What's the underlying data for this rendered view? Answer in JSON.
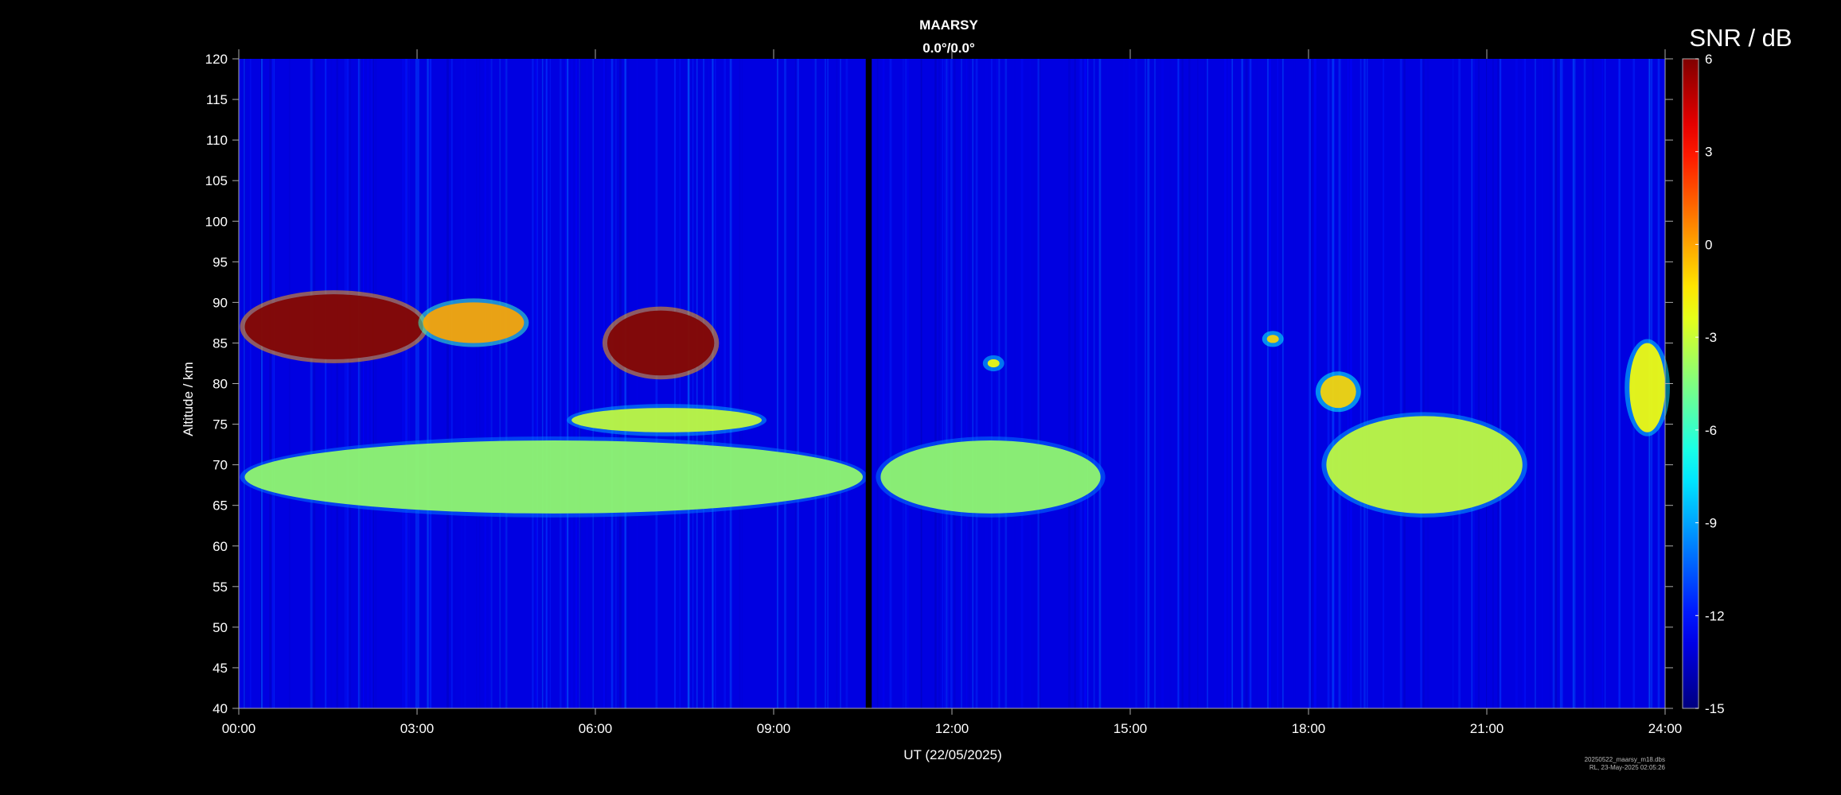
{
  "chart_data": {
    "type": "heatmap",
    "title": "MAARSY",
    "subtitle": "0.0°/0.0°",
    "xlabel": "UT (22/05/2025)",
    "ylabel": "Altitude / km",
    "xlim": [
      0,
      24
    ],
    "ylim": [
      40,
      120
    ],
    "x_tick_labels": [
      "00:00",
      "03:00",
      "06:00",
      "09:00",
      "12:00",
      "15:00",
      "18:00",
      "21:00",
      "24:00"
    ],
    "y_tick_labels": [
      "40",
      "45",
      "50",
      "55",
      "60",
      "65",
      "70",
      "75",
      "80",
      "85",
      "90",
      "95",
      "100",
      "105",
      "110",
      "115",
      "120"
    ],
    "colorbar": {
      "label": "SNR / dB",
      "range": [
        -15,
        6
      ],
      "tick_labels": [
        "6",
        "3",
        "0",
        "-3",
        "-6",
        "-9",
        "-12",
        "-15"
      ],
      "colormap": "jet"
    },
    "background_snr_db": -13,
    "data_gap_hours": [
      10.55,
      10.65
    ],
    "features": [
      {
        "x": [
          0.1,
          3.1
        ],
        "y": [
          83,
          91
        ],
        "snr_db": 6
      },
      {
        "x": [
          6.2,
          8.0
        ],
        "y": [
          81,
          89
        ],
        "snr_db": 6
      },
      {
        "x": [
          3.1,
          4.8
        ],
        "y": [
          85,
          90
        ],
        "snr_db": 0
      },
      {
        "x": [
          5.6,
          8.8
        ],
        "y": [
          74,
          77
        ],
        "snr_db": -3
      },
      {
        "x": [
          0.1,
          10.5
        ],
        "y": [
          64,
          73
        ],
        "snr_db": -4
      },
      {
        "x": [
          10.8,
          14.5
        ],
        "y": [
          64,
          73
        ],
        "snr_db": -4
      },
      {
        "x": [
          12.6,
          12.8
        ],
        "y": [
          82,
          83
        ],
        "snr_db": -2
      },
      {
        "x": [
          17.3,
          17.5
        ],
        "y": [
          85,
          86
        ],
        "snr_db": -1
      },
      {
        "x": [
          18.2,
          18.8
        ],
        "y": [
          77,
          81
        ],
        "snr_db": -1
      },
      {
        "x": [
          18.3,
          21.6
        ],
        "y": [
          64,
          76
        ],
        "snr_db": -3
      },
      {
        "x": [
          23.4,
          24.0
        ],
        "y": [
          74,
          85
        ],
        "snr_db": -2
      }
    ]
  },
  "footer": {
    "line1": "20250522_maarsy_m18.dbs",
    "line2": "RL, 23-May-2025 02:05:26"
  },
  "colors": {
    "background": "#000000",
    "axis": "#aaaaaa",
    "data_gap": "#000000"
  }
}
